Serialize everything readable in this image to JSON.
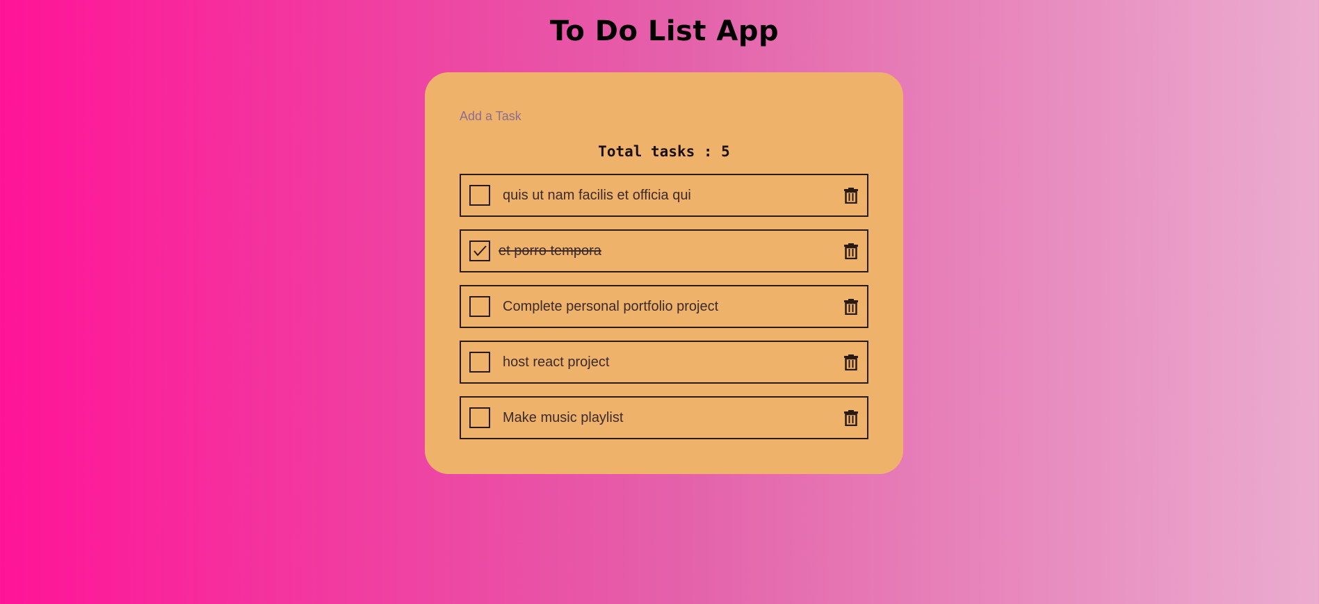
{
  "app": {
    "title": "To Do List App"
  },
  "add_task": {
    "placeholder": "Add a Task",
    "value": ""
  },
  "summary": {
    "label": "Total tasks : 5"
  },
  "tasks": [
    {
      "label": "quis ut nam facilis et officia qui",
      "completed": false
    },
    {
      "label": "et porro tempora",
      "completed": true
    },
    {
      "label": "Complete personal portfolio project",
      "completed": false
    },
    {
      "label": "host react project",
      "completed": false
    },
    {
      "label": "Make music playlist",
      "completed": false
    }
  ],
  "icons": {
    "checkbox": "square-outline-icon",
    "check": "check-icon",
    "delete": "trash-icon"
  },
  "colors": {
    "background_start": "#ff1497",
    "background_end": "#ebaccf",
    "card": "#efb26b",
    "border": "#2a1a14",
    "text": "#3b2a2a"
  }
}
